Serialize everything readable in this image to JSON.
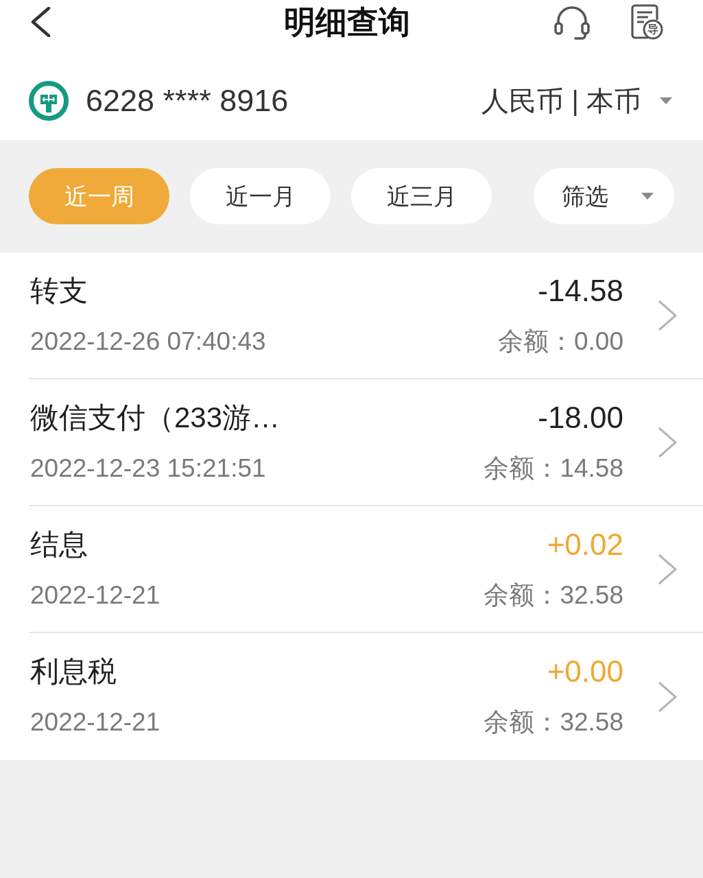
{
  "header": {
    "title": "明细查询",
    "export_badge": "导"
  },
  "account": {
    "number": "6228 **** 8916",
    "currency": "人民币 | 本币"
  },
  "period_tabs": [
    {
      "label": "近一周",
      "selected": true
    },
    {
      "label": "近一月",
      "selected": false
    },
    {
      "label": "近三月",
      "selected": false
    }
  ],
  "filter": {
    "label": "筛选"
  },
  "transactions": [
    {
      "title": "转支",
      "time": "2022-12-26 07:40:43",
      "amount": "-14.58",
      "color": "#222222",
      "balance": "余额：0.00"
    },
    {
      "title": "微信支付（233游…",
      "time": "2022-12-23 15:21:51",
      "amount": "-18.00",
      "color": "#222222",
      "balance": "余额：14.58"
    },
    {
      "title": "结息",
      "time": "2022-12-21",
      "amount": "+0.02",
      "color": "#f0a732",
      "balance": "余额：32.58"
    },
    {
      "title": "利息税",
      "time": "2022-12-21",
      "amount": "+0.00",
      "color": "#f0a732",
      "balance": "余额：32.58"
    }
  ]
}
